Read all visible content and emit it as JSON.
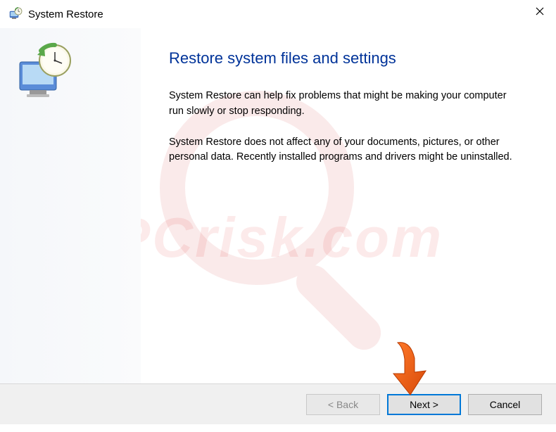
{
  "window": {
    "title": "System Restore"
  },
  "content": {
    "heading": "Restore system files and settings",
    "paragraph1": "System Restore can help fix problems that might be making your computer run slowly or stop responding.",
    "paragraph2": "System Restore does not affect any of your documents, pictures, or other personal data. Recently installed programs and drivers might be uninstalled."
  },
  "buttons": {
    "back": "< Back",
    "next": "Next >",
    "cancel": "Cancel"
  },
  "watermark": "PCrisk.com"
}
